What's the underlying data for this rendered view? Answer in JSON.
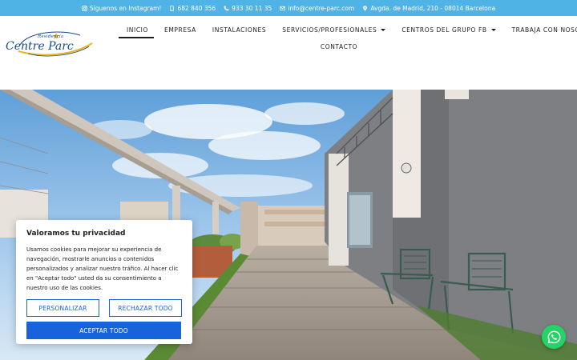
{
  "topbar": {
    "instagram": "Síguenos en Instagram!",
    "mobile": "682 840 356",
    "phone": "933 30 11 35",
    "email": "info@centre-parc.com",
    "address": "Avgda. de Madrid, 210 - 08014 Barcelona"
  },
  "logo": {
    "small": "Residencia",
    "big": "Centre Parc"
  },
  "nav": {
    "inicio": "INICIO",
    "empresa": "EMPRESA",
    "instalaciones": "INSTALACIONES",
    "servicios": "SERVICIOS/PROFESIONALES",
    "centros": "CENTROS DEL GRUPO FB",
    "trabaja": "TRABAJA CON NOSOTROS",
    "contacto": "CONTACTO"
  },
  "cookie": {
    "title": "Valoramos tu privacidad",
    "text": "Usamos cookies para mejorar su experiencia de navegación, mostrarle anuncios o contenidos personalizados y analizar nuestro tráfico. Al hacer clic en \"Aceptar todo\" usted da su consentimiento a nuestro uso de las cookies.",
    "personalize": "PERSONALIZAR",
    "reject": "RECHAZAR TODO",
    "accept": "ACEPTAR TODO"
  },
  "colors": {
    "topbar": "#4fb3e6",
    "accent": "#1863dc",
    "whatsapp": "#25d366"
  },
  "icons": [
    "instagram-icon",
    "mobile-icon",
    "phone-icon",
    "envelope-icon",
    "map-pin-icon",
    "whatsapp-icon"
  ]
}
